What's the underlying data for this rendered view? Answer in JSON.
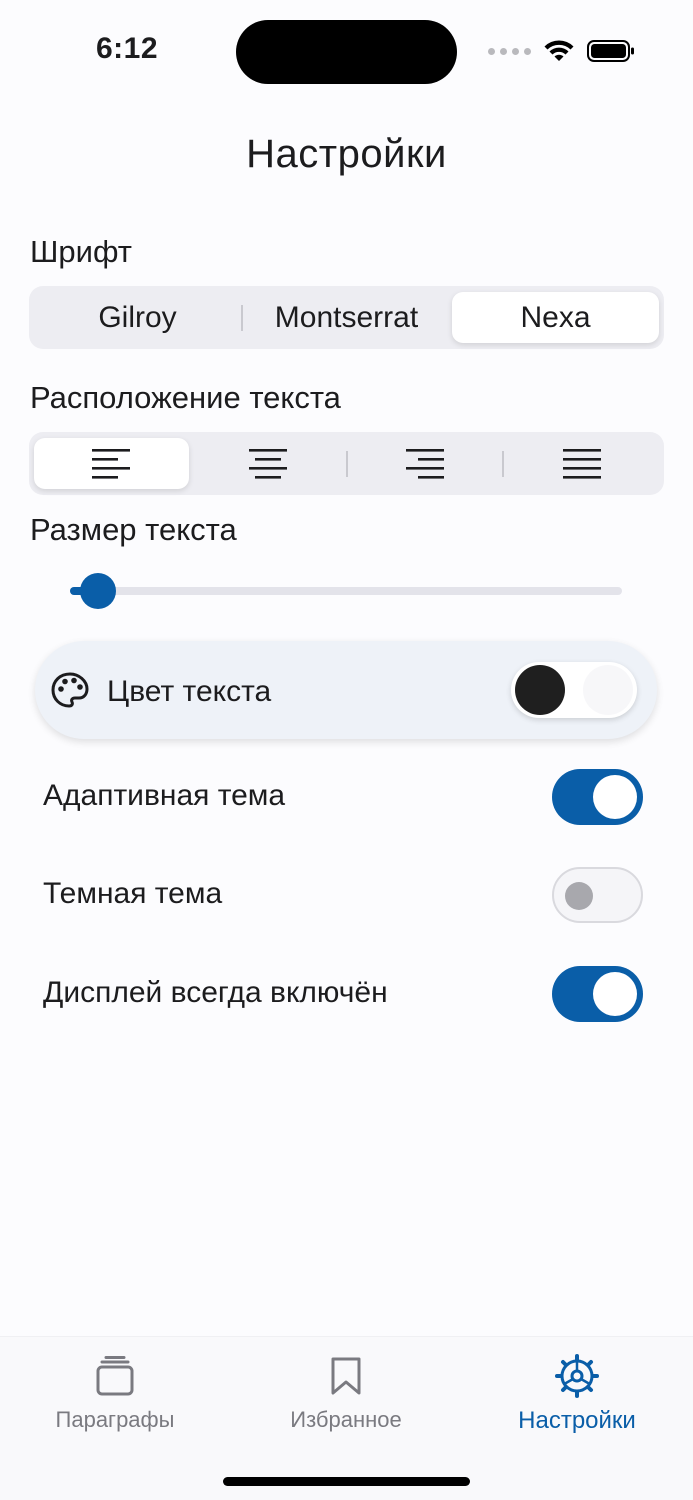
{
  "status_bar": {
    "time": "6:12"
  },
  "header": {
    "title": "Настройки"
  },
  "font_section": {
    "label": "Шрифт",
    "options": [
      "Gilroy",
      "Montserrat",
      "Nexa"
    ],
    "selected": "Nexa"
  },
  "alignment_section": {
    "label": "Расположение текста",
    "options": [
      "align-left-icon",
      "align-center-icon",
      "align-right-icon",
      "align-justify-icon"
    ],
    "selected": "align-left-icon"
  },
  "size_section": {
    "label": "Размер текста",
    "value_fraction": 0.05
  },
  "color_card": {
    "label": "Цвет текста",
    "icon": "palette-icon",
    "dark_color": "#1f1f1f",
    "light_color": "#f7f7f9"
  },
  "toggles": [
    {
      "label": "Адаптивная тема",
      "on": true
    },
    {
      "label": "Темная тема",
      "on": false
    },
    {
      "label": "Дисплей всегда включён",
      "on": true
    }
  ],
  "tabbar": {
    "tabs": [
      {
        "label": "Параграфы",
        "icon": "stack-icon",
        "active": false
      },
      {
        "label": "Избранное",
        "icon": "bookmark-icon",
        "active": false
      },
      {
        "label": "Настройки",
        "icon": "gear-icon",
        "active": true
      }
    ]
  },
  "colors": {
    "accent": "#0a5ea8",
    "background": "#fcfcfe"
  }
}
